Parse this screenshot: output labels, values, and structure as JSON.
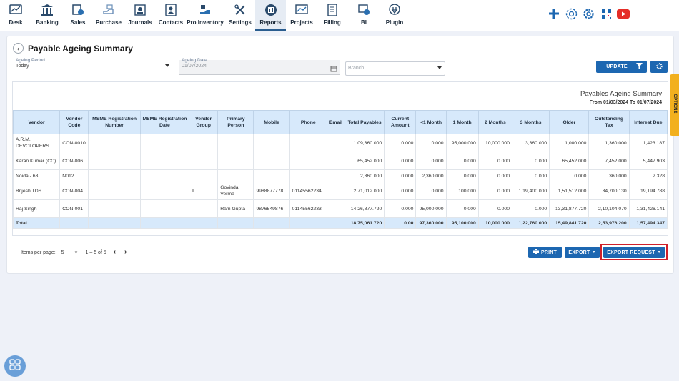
{
  "nav": {
    "items": [
      {
        "label": "Desk",
        "icon": "desk-icon"
      },
      {
        "label": "Banking",
        "icon": "bank-icon"
      },
      {
        "label": "Sales",
        "icon": "sales-icon"
      },
      {
        "label": "Purchase",
        "icon": "purchase-icon"
      },
      {
        "label": "Journals",
        "icon": "journals-icon"
      },
      {
        "label": "Contacts",
        "icon": "contacts-icon"
      },
      {
        "label": "Pro Inventory",
        "icon": "inventory-icon"
      },
      {
        "label": "Settings",
        "icon": "settings-icon"
      },
      {
        "label": "Reports",
        "icon": "reports-icon"
      },
      {
        "label": "Projects",
        "icon": "projects-icon"
      },
      {
        "label": "Filling",
        "icon": "filling-icon"
      },
      {
        "label": "BI",
        "icon": "bi-icon"
      },
      {
        "label": "Plugin",
        "icon": "plugin-icon"
      }
    ],
    "active": "Reports",
    "right_icons": [
      "plus-icon",
      "sync-icon",
      "gear-icon",
      "qr-icon",
      "youtube-icon"
    ]
  },
  "page": {
    "title": "Payable Ageing Summary",
    "ageing_period": {
      "label": "Ageing Period",
      "value": "Today"
    },
    "ageing_date": {
      "label": "Ageing Date",
      "value": "01/07/2024"
    },
    "branch": {
      "placeholder": "Branch"
    },
    "update_label": "UPDATE"
  },
  "report": {
    "title": "Payables Ageing Summary",
    "subtitle": "From 01/03/2024 To 01/07/2024",
    "columns": [
      "Vendor",
      "Vendor Code",
      "MSME Registration Number",
      "MSME Registration Date",
      "Vendor Group",
      "Primary Person",
      "Mobile",
      "Phone",
      "Email",
      "Total Payables",
      "Current Amount",
      "<1 Month",
      "1 Month",
      "2 Months",
      "3 Months",
      "Older",
      "Outstanding Tax",
      "Interest Due"
    ],
    "rows": [
      [
        "A.R.M. DEVOLOPERS.",
        "CON-0010",
        "",
        "",
        "",
        "",
        "",
        "",
        "",
        "1,09,360.000",
        "0.000",
        "0.000",
        "95,000.000",
        "10,000.000",
        "3,360.000",
        "1,000.000",
        "1,360.000",
        "1,423.187"
      ],
      [
        "Karan Kumar (CC)",
        "CON-006",
        "",
        "",
        "",
        "",
        "",
        "",
        "",
        "65,452.000",
        "0.000",
        "0.000",
        "0.000",
        "0.000",
        "0.000",
        "65,452.000",
        "7,452.000",
        "5,447.903"
      ],
      [
        "Noida - 63",
        "N012",
        "",
        "",
        "",
        "",
        "",
        "",
        "",
        "2,360.000",
        "0.000",
        "2,360.000",
        "0.000",
        "0.000",
        "0.000",
        "0.000",
        "360.000",
        "2.328"
      ],
      [
        "Brijesh TDS",
        "CON-004",
        "",
        "",
        "II",
        "Govinda Verma",
        "9988877778",
        "01145562234",
        "",
        "2,71,012.000",
        "0.000",
        "0.000",
        "100.000",
        "0.000",
        "1,19,400.000",
        "1,51,512.000",
        "34,700.130",
        "19,194.788"
      ],
      [
        "Raj Singh",
        "CON-001",
        "",
        "",
        "",
        "Ram Gupta",
        "9876549876",
        "01145562233",
        "",
        "14,26,877.720",
        "0.000",
        "95,000.000",
        "0.000",
        "0.000",
        "0.000",
        "13,31,877.720",
        "2,10,104.070",
        "1,31,426.141"
      ]
    ],
    "total": [
      "Total",
      "",
      "",
      "",
      "",
      "",
      "",
      "",
      "",
      "18,75,061.720",
      "0.00",
      "97,360.000",
      "95,100.000",
      "10,000.000",
      "1,22,760.000",
      "15,49,841.720",
      "2,53,976.200",
      "1,57,494.347"
    ]
  },
  "footer": {
    "items_per_page_label": "Items per page:",
    "items_per_page_value": "5",
    "range": "1 – 5 of 5",
    "print_label": "PRINT",
    "export_label": "EXPORT",
    "export_request_label": "EXPORT REQUEST"
  },
  "options_label": "OPTIONS",
  "colors": {
    "primary": "#1d67b1",
    "header_bg": "#d7e9fb",
    "highlight": "#d0202a",
    "options_tab": "#f2b01e"
  }
}
